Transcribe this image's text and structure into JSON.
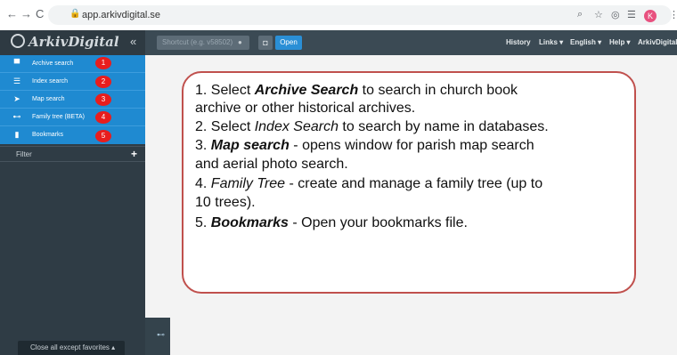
{
  "browser": {
    "back_icon": "←",
    "forward_icon": "→",
    "reload_icon": "C",
    "url": "app.arkivdigital.se"
  },
  "header": {
    "brand": "ArkivDigital",
    "collapse_icon": "«",
    "shortcut_placeholder": "Shortcut (e.g. v58502)",
    "open_label": "Open",
    "menu": [
      "History",
      "Links ▾",
      "English ▾",
      "Help ▾",
      "ArkivDigital"
    ]
  },
  "sidebar": {
    "items": [
      {
        "label": "Archive search",
        "badge": "1"
      },
      {
        "label": "Index search",
        "badge": "2"
      },
      {
        "label": "Map search",
        "badge": "3"
      },
      {
        "label": "Family tree (BETA)",
        "badge": "4"
      },
      {
        "label": "Bookmarks",
        "badge": "5"
      }
    ],
    "filter_label": "Filter",
    "filter_plus": "+",
    "close_favorites": "Close all except favorites  ▴"
  },
  "instructions": {
    "line1a": "1. Select ",
    "line1b": "Archive Search",
    "line1c": " to search in church book",
    "line2": "archive or other historical archives.",
    "line3a": "2. Select ",
    "line3b": "Index Search",
    "line3c": " to search by name in databases.",
    "line4a": "3. ",
    "line4b": "Map search",
    "line4c": " - opens window for parish map search",
    "line5": "and aerial photo search.",
    "line6a": "4. ",
    "line6b": "Family Tree",
    "line6c": " - create and manage a family tree (up to",
    "line7": "10 trees).",
    "line8a": "5. ",
    "line8b": "Bookmarks",
    "line8c": " - Open your bookmarks file."
  }
}
